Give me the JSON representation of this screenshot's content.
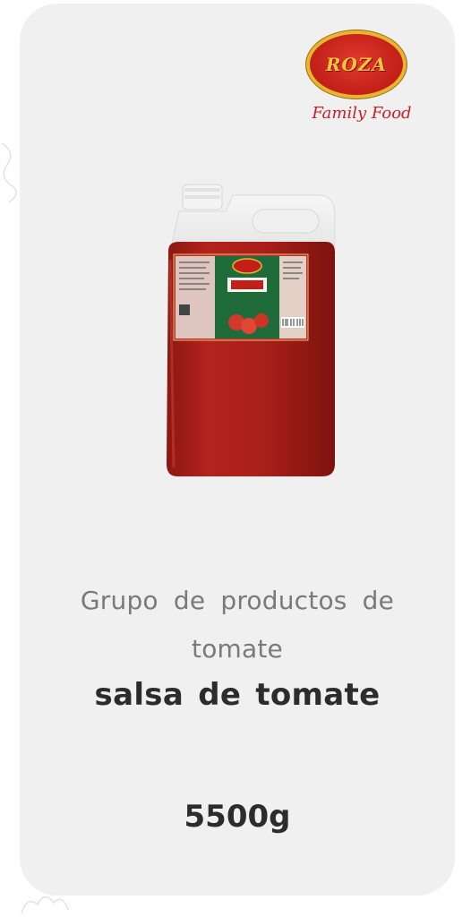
{
  "brand": {
    "logo_name": "ROZA",
    "logo_subtitle": "Family Food"
  },
  "product": {
    "image_icon": "tomato-sauce-jug-5l",
    "group_label": "Grupo de productos de tomate",
    "name": "salsa de tomate",
    "weight": "5500g"
  },
  "colors": {
    "card_bg": "#f0f0f0",
    "brand_red": "#c21f18",
    "brand_gold": "#e6b62f",
    "sauce_red": "#b3231d",
    "text_dark": "#2c2c2c",
    "text_muted": "#7a7a7a"
  }
}
